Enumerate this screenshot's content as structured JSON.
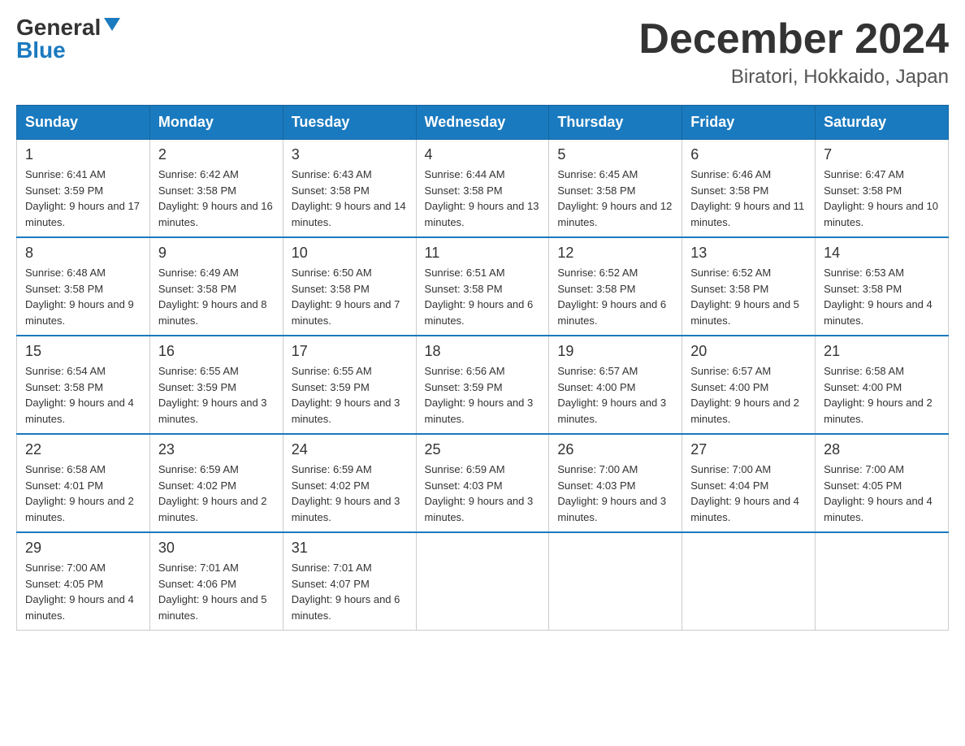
{
  "header": {
    "logo_general": "General",
    "logo_blue": "Blue",
    "month": "December 2024",
    "location": "Biratori, Hokkaido, Japan"
  },
  "weekdays": [
    "Sunday",
    "Monday",
    "Tuesday",
    "Wednesday",
    "Thursday",
    "Friday",
    "Saturday"
  ],
  "weeks": [
    [
      {
        "day": "1",
        "sunrise": "Sunrise: 6:41 AM",
        "sunset": "Sunset: 3:59 PM",
        "daylight": "Daylight: 9 hours and 17 minutes."
      },
      {
        "day": "2",
        "sunrise": "Sunrise: 6:42 AM",
        "sunset": "Sunset: 3:58 PM",
        "daylight": "Daylight: 9 hours and 16 minutes."
      },
      {
        "day": "3",
        "sunrise": "Sunrise: 6:43 AM",
        "sunset": "Sunset: 3:58 PM",
        "daylight": "Daylight: 9 hours and 14 minutes."
      },
      {
        "day": "4",
        "sunrise": "Sunrise: 6:44 AM",
        "sunset": "Sunset: 3:58 PM",
        "daylight": "Daylight: 9 hours and 13 minutes."
      },
      {
        "day": "5",
        "sunrise": "Sunrise: 6:45 AM",
        "sunset": "Sunset: 3:58 PM",
        "daylight": "Daylight: 9 hours and 12 minutes."
      },
      {
        "day": "6",
        "sunrise": "Sunrise: 6:46 AM",
        "sunset": "Sunset: 3:58 PM",
        "daylight": "Daylight: 9 hours and 11 minutes."
      },
      {
        "day": "7",
        "sunrise": "Sunrise: 6:47 AM",
        "sunset": "Sunset: 3:58 PM",
        "daylight": "Daylight: 9 hours and 10 minutes."
      }
    ],
    [
      {
        "day": "8",
        "sunrise": "Sunrise: 6:48 AM",
        "sunset": "Sunset: 3:58 PM",
        "daylight": "Daylight: 9 hours and 9 minutes."
      },
      {
        "day": "9",
        "sunrise": "Sunrise: 6:49 AM",
        "sunset": "Sunset: 3:58 PM",
        "daylight": "Daylight: 9 hours and 8 minutes."
      },
      {
        "day": "10",
        "sunrise": "Sunrise: 6:50 AM",
        "sunset": "Sunset: 3:58 PM",
        "daylight": "Daylight: 9 hours and 7 minutes."
      },
      {
        "day": "11",
        "sunrise": "Sunrise: 6:51 AM",
        "sunset": "Sunset: 3:58 PM",
        "daylight": "Daylight: 9 hours and 6 minutes."
      },
      {
        "day": "12",
        "sunrise": "Sunrise: 6:52 AM",
        "sunset": "Sunset: 3:58 PM",
        "daylight": "Daylight: 9 hours and 6 minutes."
      },
      {
        "day": "13",
        "sunrise": "Sunrise: 6:52 AM",
        "sunset": "Sunset: 3:58 PM",
        "daylight": "Daylight: 9 hours and 5 minutes."
      },
      {
        "day": "14",
        "sunrise": "Sunrise: 6:53 AM",
        "sunset": "Sunset: 3:58 PM",
        "daylight": "Daylight: 9 hours and 4 minutes."
      }
    ],
    [
      {
        "day": "15",
        "sunrise": "Sunrise: 6:54 AM",
        "sunset": "Sunset: 3:58 PM",
        "daylight": "Daylight: 9 hours and 4 minutes."
      },
      {
        "day": "16",
        "sunrise": "Sunrise: 6:55 AM",
        "sunset": "Sunset: 3:59 PM",
        "daylight": "Daylight: 9 hours and 3 minutes."
      },
      {
        "day": "17",
        "sunrise": "Sunrise: 6:55 AM",
        "sunset": "Sunset: 3:59 PM",
        "daylight": "Daylight: 9 hours and 3 minutes."
      },
      {
        "day": "18",
        "sunrise": "Sunrise: 6:56 AM",
        "sunset": "Sunset: 3:59 PM",
        "daylight": "Daylight: 9 hours and 3 minutes."
      },
      {
        "day": "19",
        "sunrise": "Sunrise: 6:57 AM",
        "sunset": "Sunset: 4:00 PM",
        "daylight": "Daylight: 9 hours and 3 minutes."
      },
      {
        "day": "20",
        "sunrise": "Sunrise: 6:57 AM",
        "sunset": "Sunset: 4:00 PM",
        "daylight": "Daylight: 9 hours and 2 minutes."
      },
      {
        "day": "21",
        "sunrise": "Sunrise: 6:58 AM",
        "sunset": "Sunset: 4:00 PM",
        "daylight": "Daylight: 9 hours and 2 minutes."
      }
    ],
    [
      {
        "day": "22",
        "sunrise": "Sunrise: 6:58 AM",
        "sunset": "Sunset: 4:01 PM",
        "daylight": "Daylight: 9 hours and 2 minutes."
      },
      {
        "day": "23",
        "sunrise": "Sunrise: 6:59 AM",
        "sunset": "Sunset: 4:02 PM",
        "daylight": "Daylight: 9 hours and 2 minutes."
      },
      {
        "day": "24",
        "sunrise": "Sunrise: 6:59 AM",
        "sunset": "Sunset: 4:02 PM",
        "daylight": "Daylight: 9 hours and 3 minutes."
      },
      {
        "day": "25",
        "sunrise": "Sunrise: 6:59 AM",
        "sunset": "Sunset: 4:03 PM",
        "daylight": "Daylight: 9 hours and 3 minutes."
      },
      {
        "day": "26",
        "sunrise": "Sunrise: 7:00 AM",
        "sunset": "Sunset: 4:03 PM",
        "daylight": "Daylight: 9 hours and 3 minutes."
      },
      {
        "day": "27",
        "sunrise": "Sunrise: 7:00 AM",
        "sunset": "Sunset: 4:04 PM",
        "daylight": "Daylight: 9 hours and 4 minutes."
      },
      {
        "day": "28",
        "sunrise": "Sunrise: 7:00 AM",
        "sunset": "Sunset: 4:05 PM",
        "daylight": "Daylight: 9 hours and 4 minutes."
      }
    ],
    [
      {
        "day": "29",
        "sunrise": "Sunrise: 7:00 AM",
        "sunset": "Sunset: 4:05 PM",
        "daylight": "Daylight: 9 hours and 4 minutes."
      },
      {
        "day": "30",
        "sunrise": "Sunrise: 7:01 AM",
        "sunset": "Sunset: 4:06 PM",
        "daylight": "Daylight: 9 hours and 5 minutes."
      },
      {
        "day": "31",
        "sunrise": "Sunrise: 7:01 AM",
        "sunset": "Sunset: 4:07 PM",
        "daylight": "Daylight: 9 hours and 6 minutes."
      },
      null,
      null,
      null,
      null
    ]
  ]
}
